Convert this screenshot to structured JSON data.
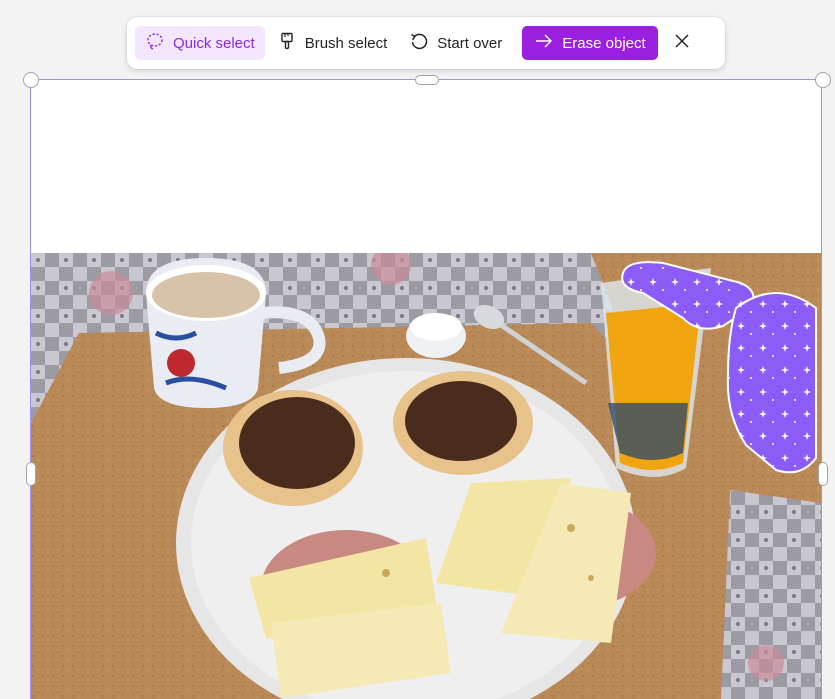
{
  "toolbar": {
    "quick_select": "Quick select",
    "brush_select": "Brush select",
    "start_over": "Start over",
    "erase_object": "Erase object"
  },
  "icons": {
    "quick_select": "lasso-icon",
    "brush_select": "brush-icon",
    "start_over": "undo-icon",
    "erase_object": "arrow-right-icon",
    "close": "close-icon"
  },
  "colors": {
    "accent": "#9b1fe0",
    "active_bg": "#f3e6fd",
    "selection_overlay": "#8b5cf6",
    "frame_border": "#a78bfa"
  }
}
